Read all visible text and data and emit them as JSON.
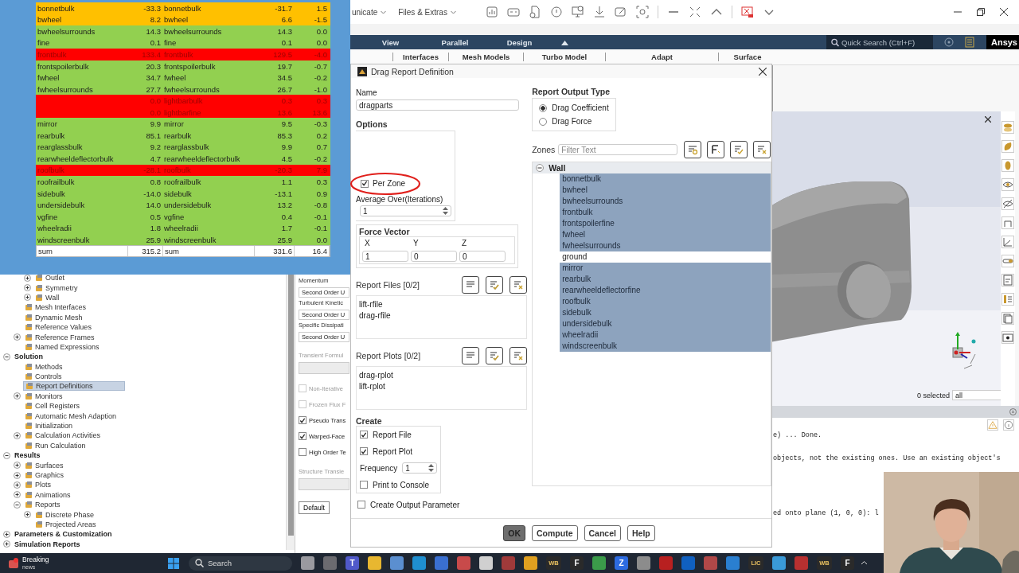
{
  "spreadsheet": {
    "rows": [
      {
        "kind": "entry",
        "name": "bonnetbulk",
        "value": "-33.3",
        "name_2": "bonnetbulk",
        "value_2": "-31.7",
        "difference": "1.5",
        "color": "#ffc000"
      },
      {
        "kind": "entry",
        "name": "bwheel",
        "value": "8.2",
        "name_2": "bwheel",
        "value_2": "6.6",
        "difference": "-1.5",
        "color": "#ffc000"
      },
      {
        "kind": "entry",
        "name": "bwheelsurrounds",
        "value": "14.3",
        "name_2": "bwheelsurrounds",
        "value_2": "14.3",
        "difference": "0.0",
        "color": "#92d050"
      },
      {
        "kind": "entry",
        "name": "fine",
        "value": "0.1",
        "name_2": "fine",
        "value_2": "0.1",
        "difference": "0.0",
        "color": "#92d050"
      },
      {
        "kind": "entry",
        "name": "frontbulk",
        "value": "133.4",
        "name_2": "frontbulk",
        "value_2": "129.5",
        "difference": "-4.0",
        "color": "#ff0000"
      },
      {
        "kind": "entry",
        "name": "frontspoilerbulk",
        "value": "20.3",
        "name_2": "frontspoilerbulk",
        "value_2": "19.7",
        "difference": "-0.7",
        "color": "#92d050"
      },
      {
        "kind": "entry",
        "name": "fwheel",
        "value": "34.7",
        "name_2": "fwheel",
        "value_2": "34.5",
        "difference": "-0.2",
        "color": "#92d050"
      },
      {
        "kind": "entry",
        "name": "fwheelsurrounds",
        "value": "27.7",
        "name_2": "fwheelsurrounds",
        "value_2": "26.7",
        "difference": "-1.0",
        "color": "#92d050"
      },
      {
        "kind": "entry",
        "value": "0.0",
        "name_2": "lightbarbulk",
        "value_2": "0.3",
        "difference": "0.3",
        "color": "#ff0000"
      },
      {
        "kind": "entry",
        "value": "0.0",
        "name_2": "lightbarfine",
        "value_2": "13.6",
        "difference": "13.6",
        "color": "#ff0000"
      },
      {
        "kind": "entry",
        "name": "mirror",
        "value": "9.9",
        "name_2": "mirror",
        "value_2": "9.5",
        "difference": "-0.3",
        "color": "#92d050"
      },
      {
        "kind": "entry",
        "name": "rearbulk",
        "value": "85.1",
        "name_2": "rearbulk",
        "value_2": "85.3",
        "difference": "0.2",
        "color": "#92d050"
      },
      {
        "kind": "entry",
        "name": "rearglassbulk",
        "value": "9.2",
        "name_2": "rearglassbulk",
        "value_2": "9.9",
        "difference": "0.7",
        "color": "#92d050"
      },
      {
        "kind": "entry",
        "name": "rearwheeldeflectorbulk",
        "value": "4.7",
        "name_2": "rearwheeldeflectorbulk",
        "value_2": "4.5",
        "difference": "-0.2",
        "color": "#92d050"
      },
      {
        "kind": "entry",
        "name": "roofbulk",
        "value": "-28.1",
        "name_2": "roofbulk",
        "value_2": "-20.3",
        "difference": "7.9",
        "color": "#ff0000"
      },
      {
        "kind": "entry",
        "name": "roofrailbulk",
        "value": "0.8",
        "name_2": "roofrailbulk",
        "value_2": "1.1",
        "difference": "0.3",
        "color": "#92d050"
      },
      {
        "kind": "entry",
        "name": "sidebulk",
        "value": "-14.0",
        "name_2": "sidebulk",
        "value_2": "-13.1",
        "difference": "0.9",
        "color": "#92d050"
      },
      {
        "kind": "entry",
        "name": "undersidebulk",
        "value": "14.0",
        "name_2": "undersidebulk",
        "value_2": "13.2",
        "difference": "-0.8",
        "color": "#92d050"
      },
      {
        "kind": "entry",
        "name": "vgfine",
        "value": "0.5",
        "name_2": "vgfine",
        "value_2": "0.4",
        "difference": "-0.1",
        "color": "#92d050"
      },
      {
        "kind": "entry",
        "name": "wheelradii",
        "value": "1.8",
        "name_2": "wheelradii",
        "value_2": "1.7",
        "difference": "-0.1",
        "color": "#92d050"
      },
      {
        "kind": "entry",
        "name": "windscreenbulk",
        "value": "25.9",
        "name_2": "windscreenbulk",
        "value_2": "25.9",
        "difference": "0.0",
        "color": "#92d050"
      },
      {
        "kind": "total",
        "name": "sum",
        "value": "315.2",
        "name_2": "sum",
        "value_2": "331.6",
        "difference": "16.4",
        "color": "#ffffff"
      }
    ]
  },
  "top_bar": {
    "menus": [
      "unicate",
      "Files & Extras"
    ]
  },
  "ribbon": {
    "tabs": [
      "View",
      "Parallel",
      "Design"
    ],
    "groups": [
      "Interfaces",
      "Mesh Models",
      "Turbo Model",
      "Adapt",
      "Surface"
    ],
    "search": {
      "placeholder": "Quick Search (Ctrl+F)"
    },
    "logo": "Ansys"
  },
  "tree": {
    "items": [
      {
        "children": [
          {
            "children": [
              {
                "label": "Outlet",
                "expanded": false
              },
              {
                "label": "Symmetry",
                "expanded": false
              },
              {
                "label": "Wall",
                "expanded": false
              }
            ]
          },
          {
            "label": "Mesh Interfaces"
          },
          {
            "label": "Dynamic Mesh"
          },
          {
            "label": "Reference Values"
          },
          {
            "label": "Reference Frames",
            "expanded": false
          },
          {
            "label": "Named Expressions"
          }
        ]
      },
      {
        "label": "Solution",
        "expanded": true,
        "children": [
          {
            "label": "Methods"
          },
          {
            "label": "Controls"
          },
          {
            "label": "Report Definitions",
            "selected": true
          },
          {
            "label": "Monitors",
            "expanded": false
          },
          {
            "label": "Cell Registers"
          },
          {
            "label": "Automatic Mesh Adaption"
          },
          {
            "label": "Initialization"
          },
          {
            "label": "Calculation Activities",
            "expanded": false
          },
          {
            "label": "Run Calculation"
          }
        ]
      },
      {
        "label": "Results",
        "expanded": true,
        "children": [
          {
            "label": "Surfaces",
            "expanded": false
          },
          {
            "label": "Graphics",
            "expanded": false
          },
          {
            "label": "Plots",
            "expanded": false
          },
          {
            "label": "Animations",
            "expanded": false
          },
          {
            "label": "Reports",
            "expanded": true,
            "children": [
              {
                "label": "Discrete Phase",
                "expanded": false
              },
              {
                "label": "Projected Areas"
              }
            ]
          }
        ]
      },
      {
        "label": "Parameters & Customization",
        "expanded": false
      },
      {
        "label": "Simulation Reports",
        "expanded": false
      }
    ]
  },
  "task_panel": {
    "items": [
      {
        "kind": "label",
        "text": "Momentum"
      },
      {
        "kind": "dropdown",
        "value": "Second Order U"
      },
      {
        "kind": "label",
        "text": "Turbulent Kinetic"
      },
      {
        "kind": "dropdown",
        "value": "Second Order U"
      },
      {
        "kind": "label",
        "text": "Specific Dissipati"
      },
      {
        "kind": "dropdown",
        "value": "Second Order U"
      },
      {
        "kind": "label",
        "text": "Transient Formul",
        "disabled": true
      },
      {
        "kind": "dropdown",
        "disabled": true
      },
      {
        "kind": "checkbox",
        "label": "Non-Iterative",
        "checked": false,
        "disabled": true
      },
      {
        "kind": "checkbox",
        "label": "Frozen Flux F",
        "checked": false,
        "disabled": true
      },
      {
        "kind": "checkbox",
        "label": "Pseudo Trans",
        "checked": true,
        "disabled": false
      },
      {
        "kind": "checkbox",
        "label": "Warped-Face",
        "checked": true,
        "disabled": false
      },
      {
        "kind": "checkbox",
        "label": "High Order Te",
        "checked": false,
        "disabled": false
      },
      {
        "kind": "label",
        "text": "Structure Transie",
        "disabled": true
      },
      {
        "kind": "dropdown",
        "disabled": true
      },
      {
        "kind": "button",
        "label": "Default"
      }
    ]
  },
  "dialog": {
    "title": "Drag Report Definition",
    "name": {
      "label": "Name",
      "value": "dragparts"
    },
    "options": {
      "title": "Options",
      "per_zone": {
        "label": "Per Zone",
        "checked": true,
        "circled": true
      },
      "average_over": {
        "label": "Average Over(Iterations)",
        "value": "1"
      }
    },
    "force_vector": {
      "title": "Force Vector",
      "components": [
        {
          "label": "X",
          "value": "1"
        },
        {
          "label": "Y",
          "value": "0"
        },
        {
          "label": "Z",
          "value": "0"
        }
      ]
    },
    "report_files": {
      "title": "Report Files [0/2]",
      "items": [
        "lift-rfile",
        "drag-rfile"
      ]
    },
    "report_plots": {
      "title": "Report Plots [0/2]",
      "items": [
        "drag-rplot",
        "lift-rplot"
      ]
    },
    "create": {
      "title": "Create",
      "report_file": {
        "label": "Report File",
        "checked": true
      },
      "report_plot": {
        "label": "Report Plot",
        "checked": true
      },
      "frequency": {
        "label": "Frequency",
        "value": "1"
      },
      "print_to_console": {
        "label": "Print to Console",
        "checked": false
      }
    },
    "create_output_parameter": {
      "label": "Create Output Parameter",
      "checked": false
    },
    "output_type": {
      "title": "Report Output Type",
      "options": [
        {
          "label": "Drag Coefficient",
          "selected": true
        },
        {
          "label": "Drag Force",
          "selected": false
        }
      ]
    },
    "zones": {
      "label": "Zones",
      "filter": {
        "placeholder": "Filter Text"
      },
      "group": {
        "label": "Wall",
        "expanded": true,
        "items": [
          {
            "label": "bonnetbulk",
            "selected": true
          },
          {
            "label": "bwheel",
            "selected": true
          },
          {
            "label": "bwheelsurrounds",
            "selected": true
          },
          {
            "label": "frontbulk",
            "selected": true
          },
          {
            "label": "frontspoilerfine",
            "selected": true
          },
          {
            "label": "fwheel",
            "selected": true
          },
          {
            "label": "fwheelsurrounds",
            "selected": true
          },
          {
            "label": "ground",
            "selected": false
          },
          {
            "label": "mirror",
            "selected": true
          },
          {
            "label": "rearbulk",
            "selected": true
          },
          {
            "label": "rearwheeldeflectorfine",
            "selected": true
          },
          {
            "label": "roofbulk",
            "selected": true
          },
          {
            "label": "sidebulk",
            "selected": true
          },
          {
            "label": "undersidebulk",
            "selected": true
          },
          {
            "label": "wheelradii",
            "selected": true
          },
          {
            "label": "windscreenbulk",
            "selected": true
          }
        ]
      }
    },
    "buttons": [
      {
        "label": "OK",
        "pressed": true
      },
      {
        "label": "Compute",
        "pressed": false
      },
      {
        "label": "Cancel",
        "pressed": false
      },
      {
        "label": "Help",
        "pressed": false
      }
    ]
  },
  "graphics": {
    "selection": "0 selected",
    "filter": "all"
  },
  "console": {
    "lines": [
      "e)  ... Done.",
      "objects, not the existing ones. Use an existing object's",
      "ed onto plane (1, 0, 0): l"
    ]
  },
  "taskbar": {
    "news": {
      "title": "Breaking",
      "subtitle": "news"
    },
    "search": "Search",
    "apps": [
      {
        "color": "#9a9aa0"
      },
      {
        "color": "#6b6b70"
      },
      {
        "color": "#5059c9",
        "label": "T"
      },
      {
        "color": "#e8b730"
      },
      {
        "color": "#5b8fd0"
      },
      {
        "color": "#1f8fd0"
      },
      {
        "color": "#3a6fd0"
      },
      {
        "color": "#c84a4a"
      },
      {
        "color": "#d0d0d0"
      },
      {
        "color": "#a03a3a"
      },
      {
        "color": "#e0a020"
      },
      {
        "color": "#2a2a2a",
        "label": "WB"
      },
      {
        "color": "#2a2a2a",
        "label": "F"
      },
      {
        "color": "#3b9b4a"
      },
      {
        "color": "#2d6be0",
        "label": "Z"
      },
      {
        "color": "#8c8c8c"
      },
      {
        "color": "#b82020"
      },
      {
        "color": "#1060c0"
      },
      {
        "color": "#b04848"
      },
      {
        "color": "#2a7fd0"
      },
      {
        "color": "#2a2a2a",
        "label": "LIC"
      },
      {
        "color": "#3a9ad8"
      },
      {
        "color": "#b83030"
      },
      {
        "color": "#2a2a2a",
        "label": "WB"
      },
      {
        "color": "#2a2a2a",
        "label": "F"
      }
    ]
  }
}
